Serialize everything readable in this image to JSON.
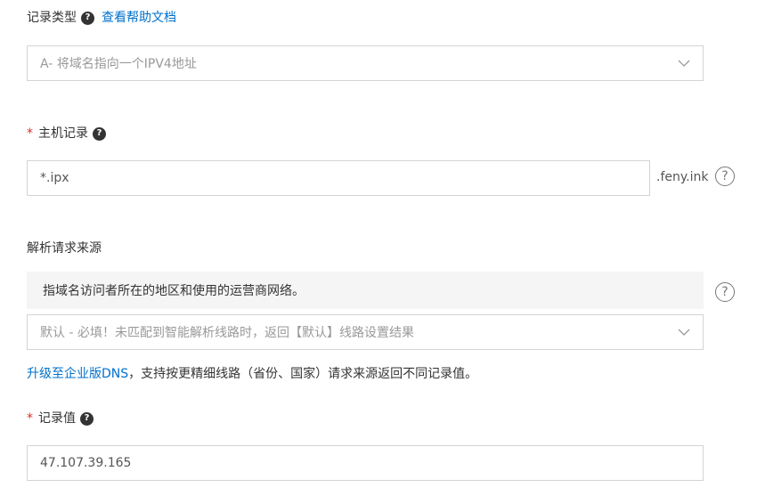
{
  "record_type": {
    "label": "记录类型",
    "help_badge": "?",
    "doc_link": "查看帮助文档",
    "selected": "A- 将域名指向一个IPV4地址"
  },
  "host_record": {
    "required_mark": "*",
    "label": "主机记录",
    "help_badge": "?",
    "value": "*.ipx",
    "suffix": ".feny.ink",
    "help_circle": "?"
  },
  "request_source": {
    "label": "解析请求来源",
    "info": "指域名访问者所在的地区和使用的运营商网络。",
    "help_circle": "?",
    "selected": "默认 - 必填！未匹配到智能解析线路时，返回【默认】线路设置结果",
    "upgrade_link": "升级至企业版DNS",
    "upgrade_text": "，支持按更精细线路（省份、国家）请求来源返回不同记录值。"
  },
  "record_value": {
    "required_mark": "*",
    "label": "记录值",
    "help_badge": "?",
    "value": "47.107.39.165"
  },
  "icons": {
    "chevron": "chevron-down-icon",
    "help": "question-circle-icon"
  }
}
